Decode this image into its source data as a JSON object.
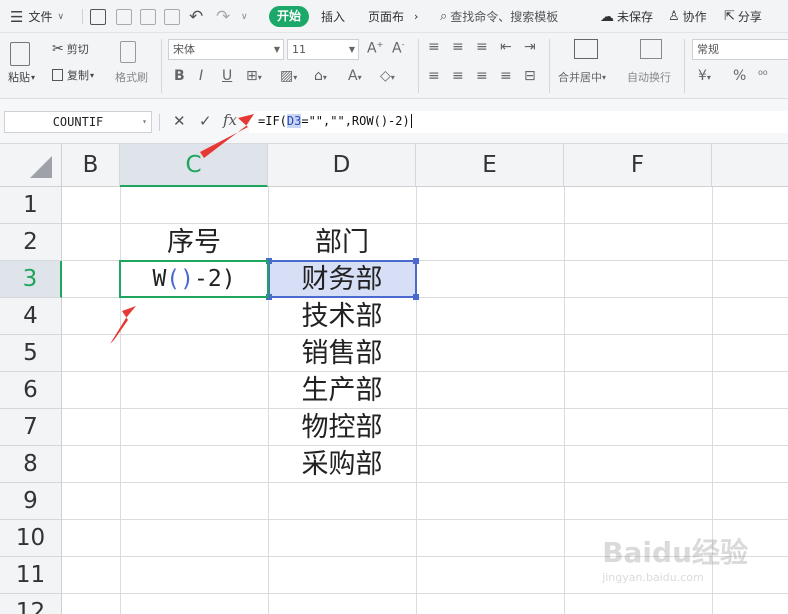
{
  "menu": {
    "file_label": "文件",
    "tabs": [
      "开始",
      "插入",
      "页面布"
    ],
    "search_placeholder": "查找命令、搜索模板",
    "unsaved_label": "未保存",
    "collab_label": "协作",
    "share_label": "分享"
  },
  "ribbon": {
    "paste_label": "粘贴",
    "cut_label": "剪切",
    "copy_label": "复制",
    "format_painter_label": "格式刷",
    "font_name": "宋体",
    "font_size": "11",
    "merge_label": "合并居中",
    "wrap_label": "自动换行",
    "number_format": "常规",
    "currency_symbol": "¥",
    "percent_symbol": "%"
  },
  "formula_bar": {
    "name_box": "COUNTIF",
    "cancel_glyph": "✕",
    "confirm_glyph": "✓",
    "fx_label": "fx",
    "formula_prefix": "=IF(",
    "formula_ref": "D3",
    "formula_suffix": "=\"\",\"\",ROW()-2)"
  },
  "grid": {
    "columns": [
      "B",
      "C",
      "D",
      "E",
      "F"
    ],
    "active_column": "C",
    "rows": [
      "1",
      "2",
      "3",
      "4",
      "5",
      "6",
      "7",
      "8",
      "9",
      "10",
      "11",
      "12"
    ],
    "active_row": "3",
    "header_c2": "序号",
    "header_d2": "部门",
    "editing_c3": {
      "pre": "W",
      "paren": "()",
      "post": "-2)"
    },
    "departments": [
      "财务部",
      "技术部",
      "销售部",
      "生产部",
      "物控部",
      "采购部"
    ]
  },
  "watermark": {
    "brand": "Baidu经验",
    "url": "jingyan.baidu.com"
  },
  "colors": {
    "accent_green": "#1fa55e",
    "ref_blue": "#4a6ad0",
    "annotation_red": "#e53935"
  }
}
